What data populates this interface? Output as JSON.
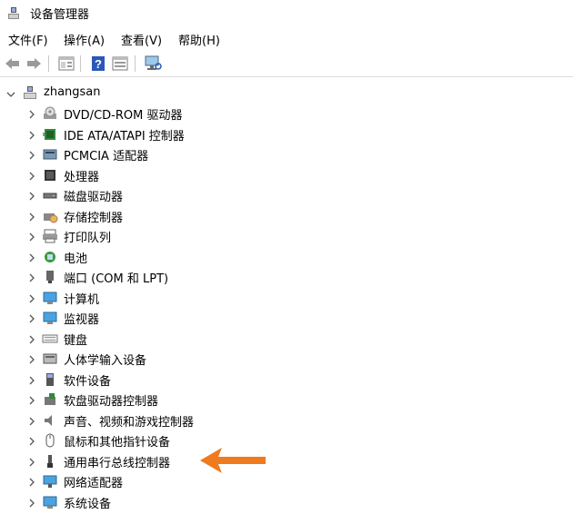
{
  "window": {
    "title": "设备管理器"
  },
  "menu": [
    {
      "label": "文件(F)"
    },
    {
      "label": "操作(A)"
    },
    {
      "label": "查看(V)"
    },
    {
      "label": "帮助(H)"
    }
  ],
  "toolbar": [
    {
      "icon": "back-arrow-icon"
    },
    {
      "icon": "forward-arrow-icon"
    },
    {
      "icon": "properties-view-icon"
    },
    {
      "icon": "help-icon"
    },
    {
      "icon": "details-view-icon"
    },
    {
      "icon": "scan-hardware-icon"
    }
  ],
  "tree": {
    "root": {
      "label": "zhangsan",
      "expanded": true,
      "icon": "computer-icon"
    },
    "items": [
      {
        "label": "DVD/CD-ROM 驱动器",
        "icon": "dvd-drive-icon"
      },
      {
        "label": "IDE ATA/ATAPI 控制器",
        "icon": "ide-controller-icon"
      },
      {
        "label": "PCMCIA 适配器",
        "icon": "pcmcia-icon"
      },
      {
        "label": "处理器",
        "icon": "processor-icon"
      },
      {
        "label": "磁盘驱动器",
        "icon": "disk-drive-icon"
      },
      {
        "label": "存储控制器",
        "icon": "storage-controller-icon"
      },
      {
        "label": "打印队列",
        "icon": "printer-icon"
      },
      {
        "label": "电池",
        "icon": "battery-icon"
      },
      {
        "label": "端口 (COM 和 LPT)",
        "icon": "port-icon"
      },
      {
        "label": "计算机",
        "icon": "computer-monitor-icon"
      },
      {
        "label": "监视器",
        "icon": "monitor-icon"
      },
      {
        "label": "键盘",
        "icon": "keyboard-icon"
      },
      {
        "label": "人体学输入设备",
        "icon": "hid-icon"
      },
      {
        "label": "软件设备",
        "icon": "software-device-icon"
      },
      {
        "label": "软盘驱动器控制器",
        "icon": "floppy-controller-icon"
      },
      {
        "label": "声音、视频和游戏控制器",
        "icon": "speaker-icon"
      },
      {
        "label": "鼠标和其他指针设备",
        "icon": "mouse-icon"
      },
      {
        "label": "通用串行总线控制器",
        "icon": "usb-icon"
      },
      {
        "label": "网络适配器",
        "icon": "network-adapter-icon"
      },
      {
        "label": "系统设备",
        "icon": "system-device-icon"
      }
    ]
  },
  "annotation": {
    "icon": "orange-pointer-arrow-icon",
    "color": "#f07a1e"
  }
}
